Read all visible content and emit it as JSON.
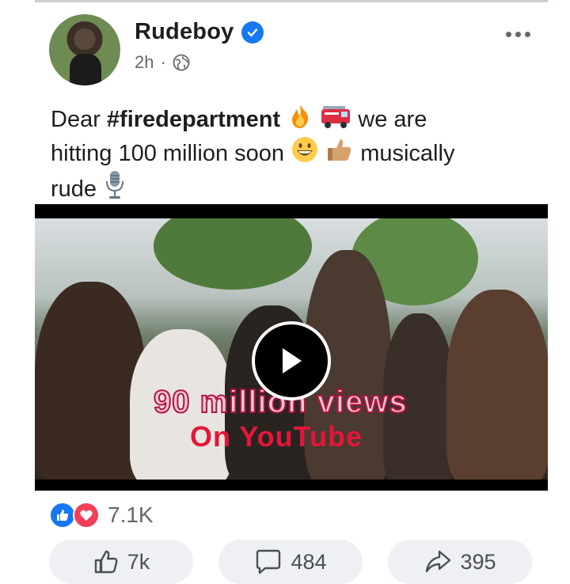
{
  "post": {
    "author": "Rudeboy",
    "time": "2h",
    "separator": "·",
    "text": {
      "line1_prefix": "Dear ",
      "hashtag": "#firedepartment",
      "line1_suffix": " we are",
      "line2": "hitting 100 million soon",
      "line2_suffix": " musically",
      "line3": "rude"
    },
    "emojis": [
      "fire-emoji",
      "fire-engine-emoji",
      "grinning-face-emoji",
      "thumbs-up-emoji",
      "microphone-emoji"
    ]
  },
  "video": {
    "overlay_line1": "90 million views",
    "overlay_line2": "On YouTube"
  },
  "reactions": {
    "count": "7.1K",
    "types": [
      "like",
      "love"
    ]
  },
  "actions": {
    "like_count": "7k",
    "comment_count": "484",
    "share_count": "395"
  },
  "colors": {
    "brand_blue": "#1877f2",
    "love_red": "#f33e58",
    "secondary_text": "#65676b"
  }
}
